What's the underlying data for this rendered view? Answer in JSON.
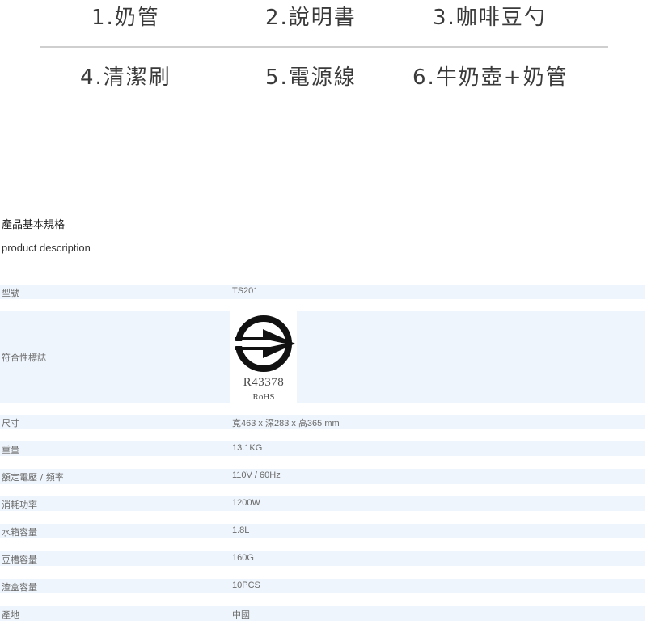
{
  "accessories": {
    "row1": [
      "1.奶管",
      "2.說明書",
      "3.咖啡豆勺"
    ],
    "row2": [
      "4.清潔刷",
      "5.電源線",
      "6.牛奶壺+奶管"
    ]
  },
  "specs": {
    "title": "產品基本規格",
    "subtitle": "product description",
    "rows": [
      {
        "label": "型號",
        "value": "TS201"
      },
      {
        "label": "符合性標誌",
        "value": "",
        "cert_code": "R43378",
        "cert_rohs": "RoHS"
      },
      {
        "label": "尺寸",
        "value": "寬463 x 深283 x 高365 mm"
      },
      {
        "label": "重量",
        "value": "13.1KG"
      },
      {
        "label": "額定電壓 / 頻率",
        "value": "110V / 60Hz"
      },
      {
        "label": "消耗功率",
        "value": "1200W"
      },
      {
        "label": "水箱容量",
        "value": "1.8L"
      },
      {
        "label": "豆槽容量",
        "value": "160G"
      },
      {
        "label": "渣盒容量",
        "value": "10PCS"
      },
      {
        "label": "產地",
        "value": "中國"
      }
    ]
  },
  "colors": {
    "row_background": "#eef5fc",
    "divider": "#cfcfcf",
    "text_dark": "#3a3a3a",
    "text_muted": "#6a6a6a"
  },
  "icons": {
    "certification_mark": "bsmi-commodity-inspection-mark-icon"
  }
}
